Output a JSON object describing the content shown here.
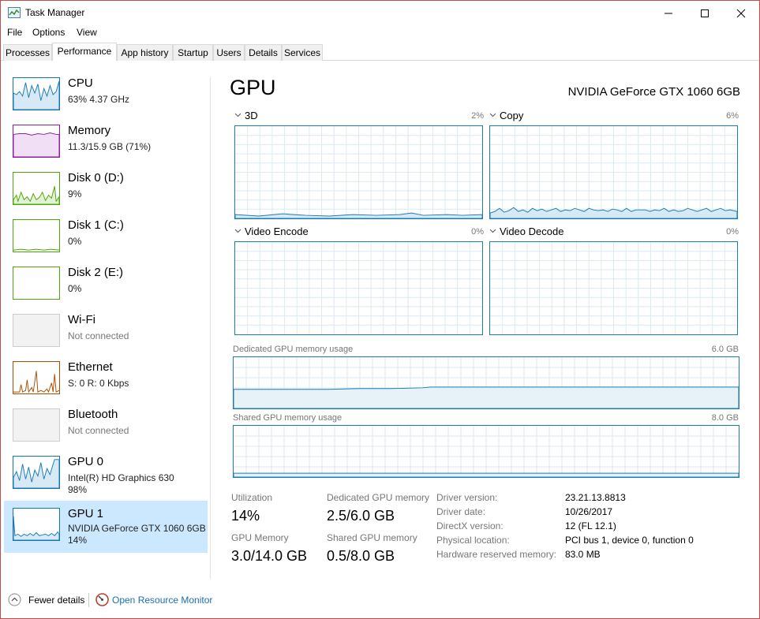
{
  "window": {
    "title": "Task Manager",
    "menu": [
      "File",
      "Options",
      "View"
    ],
    "controls": {
      "minimize": "─",
      "maximize": "☐",
      "close": "✕"
    }
  },
  "tabs": [
    "Processes",
    "Performance",
    "App history",
    "Startup",
    "Users",
    "Details",
    "Services"
  ],
  "active_tab": "Performance",
  "sidebar": {
    "items": [
      {
        "name": "CPU",
        "sub": "63% 4.37 GHz",
        "sub2": "",
        "color": "#1b7cb3"
      },
      {
        "name": "Memory",
        "sub": "11.3/15.9 GB (71%)",
        "sub2": "",
        "color": "#8b1ea3"
      },
      {
        "name": "Disk 0 (D:)",
        "sub": "9%",
        "sub2": "",
        "color": "#4da60c"
      },
      {
        "name": "Disk 1 (C:)",
        "sub": "0%",
        "sub2": "",
        "color": "#4da60c"
      },
      {
        "name": "Disk 2 (E:)",
        "sub": "0%",
        "sub2": "",
        "color": "#4da60c"
      },
      {
        "name": "Wi-Fi",
        "sub": "Not connected",
        "sub2": "",
        "color": "#ccc"
      },
      {
        "name": "Ethernet",
        "sub": "S: 0 R: 0 Kbps",
        "sub2": "",
        "color": "#a74f01"
      },
      {
        "name": "Bluetooth",
        "sub": "Not connected",
        "sub2": "",
        "color": "#ccc"
      },
      {
        "name": "GPU 0",
        "sub": "Intel(R) HD Graphics 630",
        "sub2": "98%",
        "color": "#1b7cb3"
      },
      {
        "name": "GPU 1",
        "sub": "NVIDIA GeForce GTX 1060 6GB",
        "sub2": "14%",
        "color": "#1b7cb3"
      }
    ],
    "selected": "GPU 1"
  },
  "main": {
    "title": "GPU",
    "model": "NVIDIA GeForce GTX 1060 6GB",
    "graphs": [
      {
        "label": "3D",
        "pct": "2%"
      },
      {
        "label": "Copy",
        "pct": "6%"
      },
      {
        "label": "Video Encode",
        "pct": "0%"
      },
      {
        "label": "Video Decode",
        "pct": "0%"
      }
    ],
    "dedicated_label": "Dedicated GPU memory usage",
    "dedicated_max": "6.0 GB",
    "shared_label": "Shared GPU memory usage",
    "shared_max": "8.0 GB",
    "stats": {
      "utilization_label": "Utilization",
      "utilization": "14%",
      "dedicated_label": "Dedicated GPU memory",
      "dedicated": "2.5/6.0 GB",
      "gpu_memory_label": "GPU Memory",
      "gpu_memory": "3.0/14.0 GB",
      "shared_label": "Shared GPU memory",
      "shared": "0.5/8.0 GB"
    },
    "info": [
      {
        "label": "Driver version:",
        "value": "23.21.13.8813"
      },
      {
        "label": "Driver date:",
        "value": "10/26/2017"
      },
      {
        "label": "DirectX version:",
        "value": "12 (FL 12.1)"
      },
      {
        "label": "Physical location:",
        "value": "PCI bus 1, device 0, function 0"
      },
      {
        "label": "Hardware reserved memory:",
        "value": "83.0 MB"
      }
    ]
  },
  "footer": {
    "fewer_details": "Fewer details",
    "open_monitor": "Open Resource Monitor"
  }
}
